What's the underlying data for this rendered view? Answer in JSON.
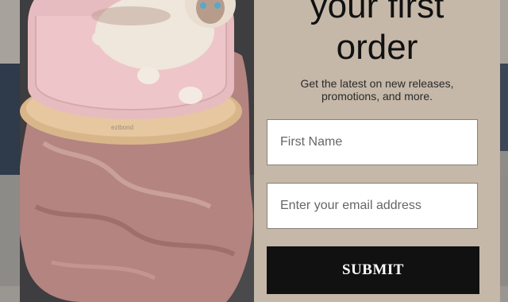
{
  "popup": {
    "title_line1": "your first",
    "title_line2": "order",
    "subtitle": "Get the latest on new releases, promotions, and more.",
    "first_name_placeholder": "First Name",
    "email_placeholder": "Enter your email address",
    "submit_label": "SUBMIT",
    "bed_brand": "ezibond"
  },
  "colors": {
    "modal_background": "#c5b8a8",
    "submit_background": "#111111",
    "field_background": "#ffffff"
  }
}
